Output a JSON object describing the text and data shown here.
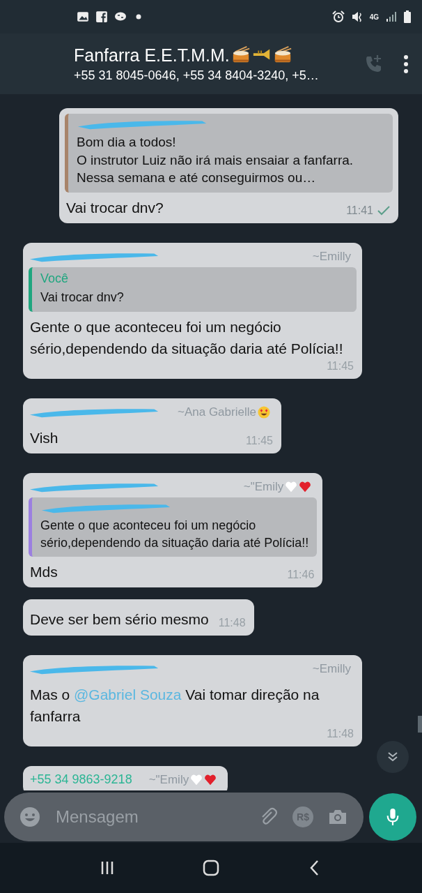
{
  "status_bar": {
    "notification_icons": [
      {
        "kind": "gallery"
      },
      {
        "kind": "facebook"
      },
      {
        "kind": "ca"
      },
      {
        "kind": "dot"
      }
    ],
    "network": "4G"
  },
  "header": {
    "title": "Fanfarra E.E.T.M.M.",
    "title_emojis": [
      {
        "kind": "drum"
      },
      {
        "kind": "trumpet"
      },
      {
        "kind": "drum"
      }
    ],
    "subtitle": "+55 31 8045-0646, +55 34 8404-3240, +5…"
  },
  "messages": [
    {
      "kind": "outgoing",
      "quote": {
        "author_redacted": true,
        "color": "#a8846a",
        "text": "Bom dia a todos!\nO instrutor Luiz não irá mais ensaiar a fanfarra. Nessa semana e até conseguirmos ou…"
      },
      "text_parts": [
        {
          "kind": "plain",
          "text": "Vai trocar dnv?"
        }
      ],
      "time": "11:41",
      "sent": true
    },
    {
      "kind": "incoming",
      "sender_redacted": true,
      "sender_name": "~Emilly",
      "quote": {
        "author": "Você",
        "color": "#1fa67f",
        "text": "Vai trocar dnv?"
      },
      "text_parts": [
        {
          "kind": "plain",
          "text": "Gente o que aconteceu foi um negócio sério,dependendo da situação daria até Polícia!!"
        }
      ],
      "time": "11:45"
    },
    {
      "kind": "incoming",
      "sender_redacted": true,
      "sender_name": "~Ana Gabrielle",
      "name_emojis": [
        {
          "kind": "heart-eyes"
        }
      ],
      "text_parts": [
        {
          "kind": "plain",
          "text": "Vish"
        }
      ],
      "time": "11:45"
    },
    {
      "kind": "incoming",
      "sender_redacted": true,
      "sender_name": "~\"Emily",
      "name_emojis": [
        {
          "kind": "white-heart"
        },
        {
          "kind": "red-heart"
        }
      ],
      "quote": {
        "author_redacted": true,
        "color": "#9b7fe0",
        "text": "Gente o que aconteceu foi um negócio\nsério,dependendo da situação daria até Polícia!!"
      },
      "text_parts": [
        {
          "kind": "plain",
          "text": "Mds"
        }
      ],
      "time": "11:46"
    },
    {
      "kind": "incoming",
      "text_parts": [
        {
          "kind": "plain",
          "text": "Deve ser bem sério mesmo"
        }
      ],
      "time": "11:48"
    },
    {
      "kind": "incoming",
      "sender_redacted": true,
      "sender_name": "~Emilly",
      "text_parts": [
        {
          "kind": "plain",
          "text": "Mas o "
        },
        {
          "kind": "mention",
          "text": "@Gabriel Souza"
        },
        {
          "kind": "plain",
          "text": " Vai tomar direção na fanfarra"
        }
      ],
      "time": "11:48"
    },
    {
      "kind": "incoming",
      "sender": "+55 34 9863-9218",
      "sender_name": "~\"Emily",
      "name_emojis": [
        {
          "kind": "white-heart"
        },
        {
          "kind": "red-heart"
        }
      ]
    }
  ],
  "composer": {
    "placeholder": "Mensagem",
    "payment_label": "R$"
  }
}
